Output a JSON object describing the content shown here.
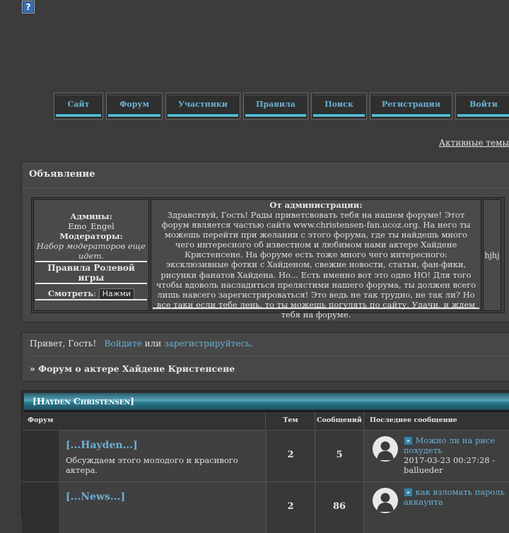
{
  "help_icon": "?",
  "nav": {
    "items": [
      {
        "label": "Сайт"
      },
      {
        "label": "Форум"
      },
      {
        "label": "Участники"
      },
      {
        "label": "Правила"
      },
      {
        "label": "Поиск"
      },
      {
        "label": "Регистрация"
      },
      {
        "label": "Войти"
      }
    ]
  },
  "active_topics": "Активные темы",
  "announcement": {
    "title": "Объявление",
    "admins_label": "Админы:",
    "admins_value": "Emo_Engel",
    "moderators_label": "Модераторы:",
    "moderators_value": "Набор модераторов еще идет.",
    "rp_rules_label": "Правила Ролевой игры",
    "view_label": "Смотреть",
    "press_button": "Нажми",
    "from_admin_title": "От администрации:",
    "from_admin_text": "Здравствуй, Гость! Рады приветсвовать тебя на нашем форуме! Этот форум является частью сайта www.christensen-fan.ucoz.org. На него ты можешь перейти при желании с этого форума, где ты найдешь много чего интересного об известном и любимом нами актере Хайдене Кристенсене. На форуме есть тоже много чего интересного: эксклюзивные фотки с Хайденом, свежие новости, статьи, фан-фики, рисунки фанатов Хайдена. Но... Есть именно вот это одно НО! Для того чтобы вдоволь насладиться прелястими нашего форума, ты должен всего лишь навсего зарегистрироваться! Это ведь не так трудно, не так ли? Но все таки если тебе лень, то ты можешь погулять по сайту. Удачи, и ждем тебя на форуме.",
    "right_text": "hjhj"
  },
  "guest": {
    "greeting": "Привет, Гость!",
    "login_link": "Войдите",
    "or": "или",
    "register_link": "зарегистрируйтесь",
    "period": ".",
    "crumb": "» Форум о актере Хайдене Кристенсене"
  },
  "category": {
    "title": "[Hayden Christensen]",
    "columns": {
      "forum": "Форум",
      "topics": "Тем",
      "posts": "Сообщений",
      "last": "Последнее сообщение"
    },
    "rows": [
      {
        "title": "[...Hayden...]",
        "desc": "Обсуждаем этого молодого и красивого актера.",
        "topics": "2",
        "posts": "5",
        "last_title": "Можно ли на рисе похудеть",
        "last_meta": "2017-03-23 00:27:28 - ballueder"
      },
      {
        "title": "[...News...]",
        "desc": "",
        "topics": "2",
        "posts": "86",
        "last_title": "как взломать пароль аккаунта",
        "last_meta": ""
      }
    ]
  },
  "colors": {
    "background": "#3c3c3c",
    "link": "#6ab0d4",
    "accent": "#57a3b8"
  }
}
